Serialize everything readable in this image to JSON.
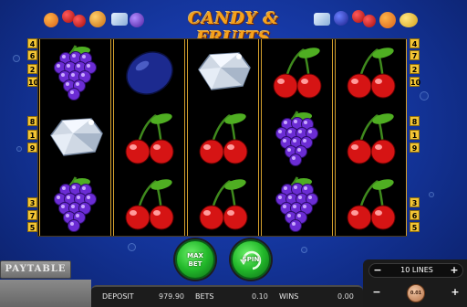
{
  "game": {
    "title": "CANDY & FRUITS"
  },
  "reels": [
    [
      "grapes",
      "diamond",
      "grapes"
    ],
    [
      "plum",
      "cherries",
      "cherries"
    ],
    [
      "diamond",
      "cherries",
      "cherries"
    ],
    [
      "cherries",
      "grapes",
      "grapes"
    ],
    [
      "cherries",
      "cherries",
      "cherries"
    ]
  ],
  "paylines": {
    "left": [
      "4",
      "6",
      "2",
      "10",
      "8",
      "1",
      "9",
      "3",
      "7",
      "5"
    ],
    "right": [
      "4",
      "7",
      "2",
      "10",
      "8",
      "1",
      "9",
      "3",
      "6",
      "5"
    ]
  },
  "controls": {
    "paytable_label": "PAYTABLE",
    "max_bet_label": "MAX\nBET",
    "spin_label": "SPIN",
    "lines_value": "10 LINES",
    "minus_symbol": "−",
    "plus_symbol": "+",
    "coin_value": "0.01"
  },
  "status": {
    "deposit_label": "DEPOSIT",
    "deposit_value": "979.90",
    "bets_label": "BETS",
    "bets_value": "0.10",
    "wins_label": "WINS",
    "wins_value": "0.00"
  },
  "colors": {
    "background": "#1f47c8",
    "reel_border": "#d4a02e",
    "title": "#f7a21a",
    "button_green": "#22b82a",
    "payline_yellow": "#f3c534"
  }
}
